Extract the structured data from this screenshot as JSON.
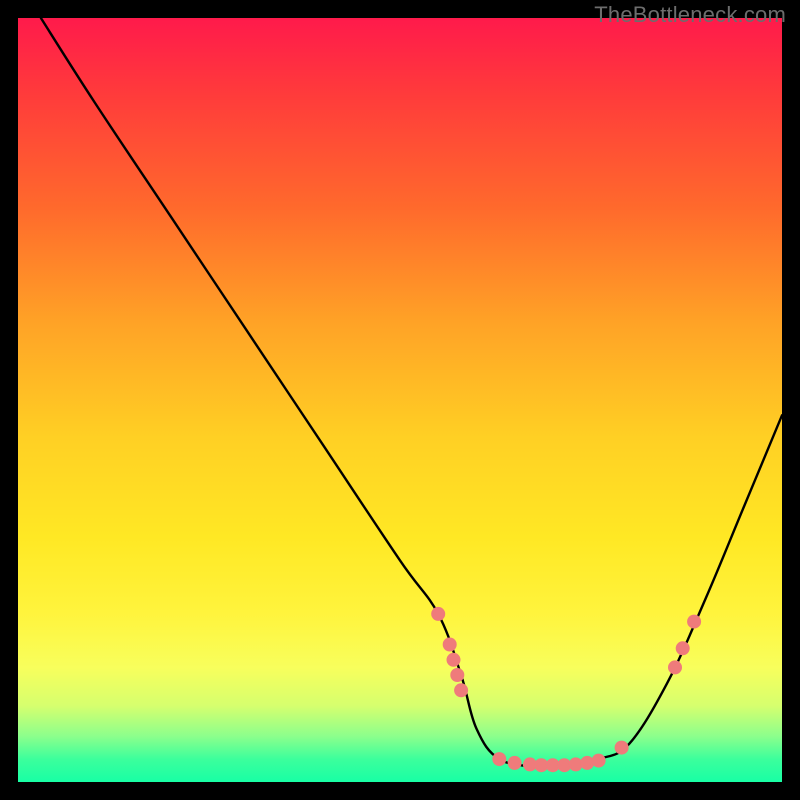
{
  "watermark": "TheBottleneck.com",
  "chart_data": {
    "type": "line",
    "title": "",
    "xlabel": "",
    "ylabel": "",
    "xlim": [
      0,
      100
    ],
    "ylim": [
      0,
      100
    ],
    "series": [
      {
        "name": "curve",
        "x": [
          3,
          10,
          20,
          30,
          40,
          50,
          55,
          58,
          60,
          63,
          68,
          72,
          76,
          80,
          85,
          90,
          95,
          100
        ],
        "y": [
          100,
          89,
          74,
          59,
          44,
          29,
          22,
          14,
          7,
          3,
          2,
          2,
          3,
          5,
          13,
          24,
          36,
          48
        ]
      }
    ],
    "markers": [
      {
        "x": 55.0,
        "y": 22.0
      },
      {
        "x": 56.5,
        "y": 18.0
      },
      {
        "x": 57.0,
        "y": 16.0
      },
      {
        "x": 57.5,
        "y": 14.0
      },
      {
        "x": 58.0,
        "y": 12.0
      },
      {
        "x": 63.0,
        "y": 3.0
      },
      {
        "x": 65.0,
        "y": 2.5
      },
      {
        "x": 67.0,
        "y": 2.3
      },
      {
        "x": 68.5,
        "y": 2.2
      },
      {
        "x": 70.0,
        "y": 2.2
      },
      {
        "x": 71.5,
        "y": 2.2
      },
      {
        "x": 73.0,
        "y": 2.3
      },
      {
        "x": 74.5,
        "y": 2.5
      },
      {
        "x": 76.0,
        "y": 2.8
      },
      {
        "x": 79.0,
        "y": 4.5
      },
      {
        "x": 86.0,
        "y": 15.0
      },
      {
        "x": 87.0,
        "y": 17.5
      },
      {
        "x": 88.5,
        "y": 21.0
      }
    ]
  }
}
